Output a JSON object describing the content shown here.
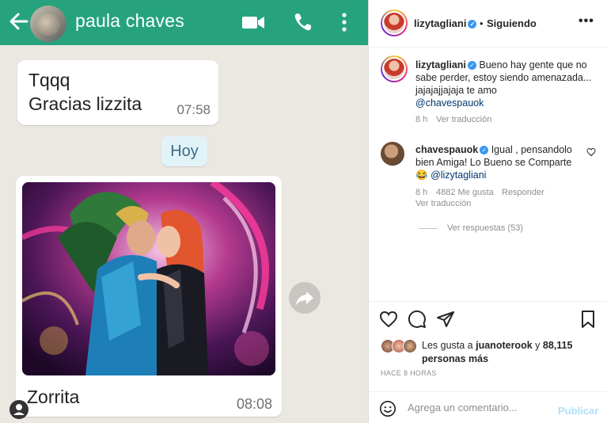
{
  "whatsapp": {
    "contact_name": "paula chaves",
    "messages": [
      {
        "line1": "Tqqq",
        "line2": "Gracias lizzita",
        "time": "07:58"
      }
    ],
    "day_separator": "Hoy",
    "photo_message": {
      "caption": "Zorrita",
      "time": "08:08"
    },
    "icons": [
      "back-arrow-icon",
      "video-call-icon",
      "phone-icon",
      "more-vertical-icon",
      "forward-icon",
      "account-icon"
    ],
    "colors": {
      "header": "#26a37d",
      "chat_bg": "#ebe7e1",
      "day_badge": "#e2f3f8"
    }
  },
  "instagram": {
    "post_author": "lizytagliani",
    "follow_status": "Siguiendo",
    "caption": {
      "user": "lizytagliani",
      "text": "Bueno hay gente que no sabe perder, estoy siendo amenazada... jajajajjajaja te amo",
      "mention": "@chavespauok",
      "age": "8 h",
      "translate": "Ver traducción"
    },
    "comment": {
      "user": "chavespauok",
      "text": "Igual , pensandolo bien Amiga! Lo Bueno se Comparte 😂",
      "mention": "@lizytagliani",
      "age": "8 h",
      "likes": "4882 Me gusta",
      "reply": "Responder",
      "translate": "Ver traducción",
      "view_replies": "Ver respuestas (53)"
    },
    "likes": {
      "prefix": "Les gusta a",
      "user": "juanoterook",
      "connector": "y",
      "others": "88,115 personas más"
    },
    "post_time": "HACE 8 HORAS",
    "add_comment": {
      "placeholder": "Agrega un comentario...",
      "publish": "Publicar"
    },
    "icons": [
      "heart-icon",
      "comment-icon",
      "share-icon",
      "bookmark-icon",
      "emoji-icon",
      "more-options-icon"
    ]
  }
}
